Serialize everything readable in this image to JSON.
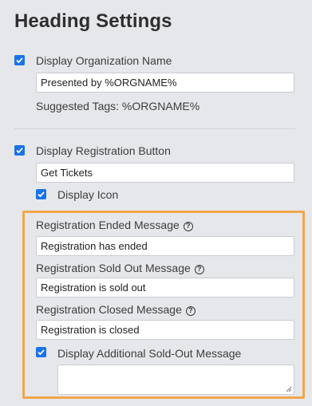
{
  "page_title": "Heading Settings",
  "org_name": {
    "checkbox_label": "Display Organization Name",
    "checked": true,
    "input_value": "Presented by %ORGNAME%",
    "suggested_tags": "Suggested Tags: %ORGNAME%"
  },
  "registration_button": {
    "checkbox_label": "Display Registration Button",
    "checked": true,
    "input_value": "Get Tickets",
    "display_icon_label": "Display Icon",
    "display_icon_checked": true
  },
  "messages": {
    "ended": {
      "label": "Registration Ended Message",
      "value": "Registration has ended"
    },
    "sold_out": {
      "label": "Registration Sold Out Message",
      "value": "Registration is sold out"
    },
    "closed": {
      "label": "Registration Closed Message",
      "value": "Registration is closed"
    },
    "additional": {
      "label": "Display Additional Sold-Out Message",
      "checked": true,
      "value": ""
    },
    "help_glyph": "?"
  },
  "colors": {
    "accent": "#1a73e8",
    "highlight_border": "#f2a64a",
    "background": "#e6e7eb"
  }
}
